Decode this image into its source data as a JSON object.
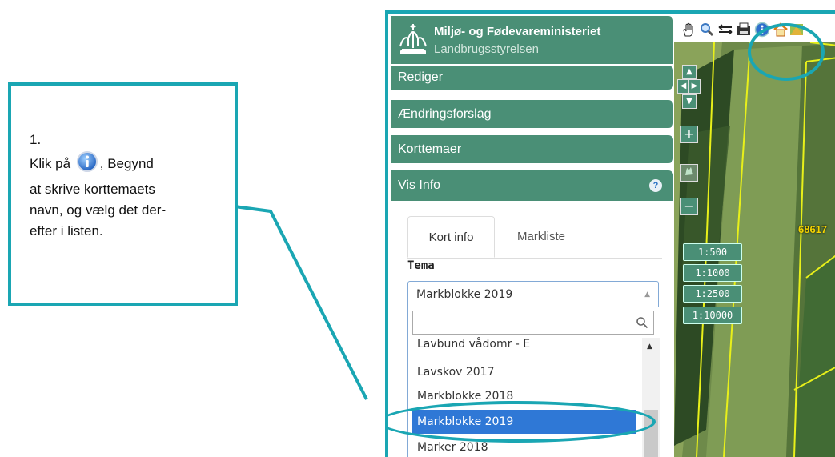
{
  "callout": {
    "step": "1.",
    "line_prefix": "Klik på",
    "line_suffix": ", Begynd",
    "rest": "at skrive korttemaets navn, og vælg det der-efter i listen.",
    "rest_lines": [
      "at skrive korttemaets",
      "navn, og vælg det der-",
      "efter i listen."
    ]
  },
  "sidebar": {
    "ministry_title": "Miljø- og Fødevareministeriet",
    "ministry_sub": "Landbrugsstyrelsen",
    "sections": {
      "rediger": "Rediger",
      "aendringsforslag": "Ændringsforslag",
      "korttemaer": "Korttemaer",
      "vis_info": "Vis Info"
    },
    "help_glyph": "?",
    "tabs": {
      "kort_info": "Kort info",
      "markliste": "Markliste"
    },
    "tema_label": "Tema",
    "select_value": "Markblokke 2019",
    "search_placeholder": "",
    "options": [
      "Lavbund vådomr - E",
      "Lavskov 2017",
      "Markblokke 2018",
      "Markblokke 2019",
      "Marker 2018"
    ],
    "selected_option": "Markblokke 2019"
  },
  "map": {
    "scales": [
      "1:500",
      "1:1000",
      "1:2500",
      "1:10000"
    ],
    "parcel_label": "68617",
    "tools": [
      "pan-hand-icon",
      "zoom-icon",
      "measure-icon",
      "print-icon",
      "info-icon",
      "home-icon",
      "layers-icon"
    ],
    "nav_glyphs": {
      "up": "▲",
      "left": "◀",
      "right": "▶",
      "down": "▼",
      "zoom_in": "+",
      "zoom_out": "−"
    }
  },
  "colors": {
    "accent": "#1aa6b3",
    "sidebar_green": "#4a8f76",
    "selected_blue": "#2f78d6",
    "field_outline": "#e8f01a"
  }
}
